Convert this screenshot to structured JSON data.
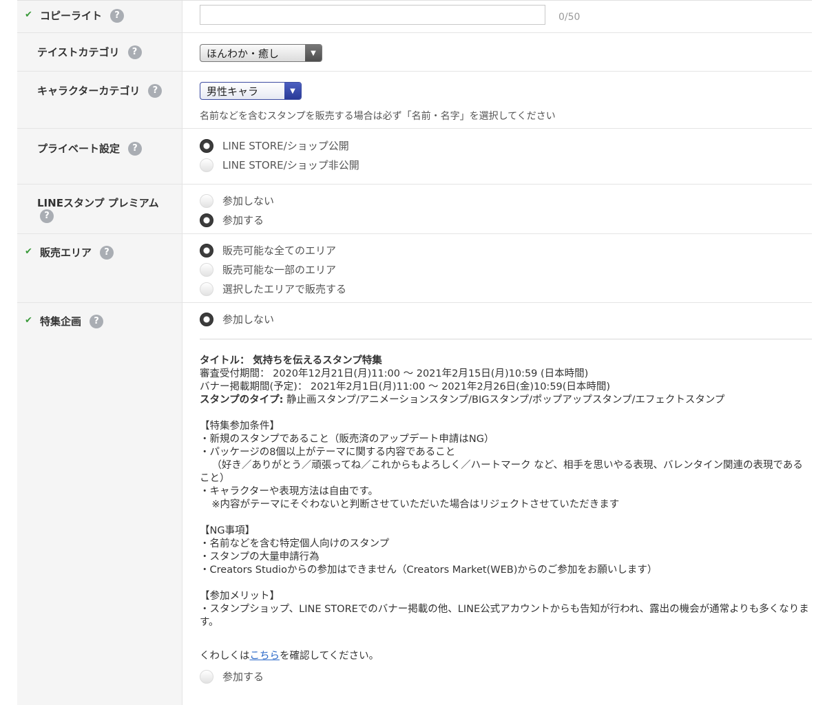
{
  "rows": {
    "copyright": {
      "label": "コピーライト",
      "checked": true,
      "counter": "0/50",
      "value": ""
    },
    "taste": {
      "label": "テイストカテゴリ",
      "selected": "ほんわか・癒し"
    },
    "character": {
      "label": "キャラクターカテゴリ",
      "selected": "男性キャラ",
      "note": "名前などを含むスタンプを販売する場合は必ず「名前・名字」を選択してください"
    },
    "privacy": {
      "label": "プライベート設定",
      "options": [
        "LINE STORE/ショップ公開",
        "LINE STORE/ショップ非公開"
      ],
      "selected_index": 0
    },
    "premium": {
      "label": "LINEスタンプ プレミアム",
      "options": [
        "参加しない",
        "参加する"
      ],
      "selected_index": 1
    },
    "area": {
      "label": "販売エリア",
      "checked": true,
      "options": [
        "販売可能な全てのエリア",
        "販売可能な一部のエリア",
        "選択したエリアで販売する"
      ],
      "selected_index": 0
    },
    "feature": {
      "label": "特集企画",
      "checked": true,
      "options": [
        "参加しない",
        "参加する"
      ],
      "selected_index": 0
    }
  },
  "help_glyph": "?",
  "check_glyph": "✔",
  "feature_info": {
    "title_label": "タイトル：",
    "title_value": "気持ちを伝えるスタンプ特集",
    "review_period": "審査受付期間： 2020年12月21日(月)11:00 〜 2021年2月15日(月)10:59 (日本時間)",
    "banner_period": "バナー掲載期間(予定)： 2021年2月1日(月)11:00 〜 2021年2月26日(金)10:59(日本時間)",
    "types_label": "スタンプのタイプ:",
    "types_value": "静止画スタンプ/アニメーションスタンプ/BIGスタンプ/ポップアップスタンプ/エフェクトスタンプ",
    "conditions_heading": "【特集参加条件】",
    "conditions": [
      "・新規のスタンプであること（販売済のアップデート申請はNG）",
      "・パッケージの8個以上がテーマに関する内容であること",
      "（好き／ありがとう／頑張ってね／これからもよろしく／ハートマーク など、相手を思いやる表現、バレンタイン関連の表現であること）",
      "・キャラクターや表現方法は自由です。",
      "※内容がテーマにそぐわないと判断させていただいた場合はリジェクトさせていただきます"
    ],
    "ng_heading": "【NG事項】",
    "ng_items": [
      "・名前などを含む特定個人向けのスタンプ",
      "・スタンプの大量申請行為",
      "・Creators Studioからの参加はできません（Creators Market(WEB)からのご参加をお願いします）"
    ],
    "merit_heading": "【参加メリット】",
    "merit_items": [
      "・スタンプショップ、LINE STOREでのバナー掲載の他、LINE公式アカウントからも告知が行われ、露出の機会が通常よりも多くなります。"
    ],
    "more_prefix": "くわしくは",
    "more_link": "こちら",
    "more_suffix": "を確認してください。"
  }
}
